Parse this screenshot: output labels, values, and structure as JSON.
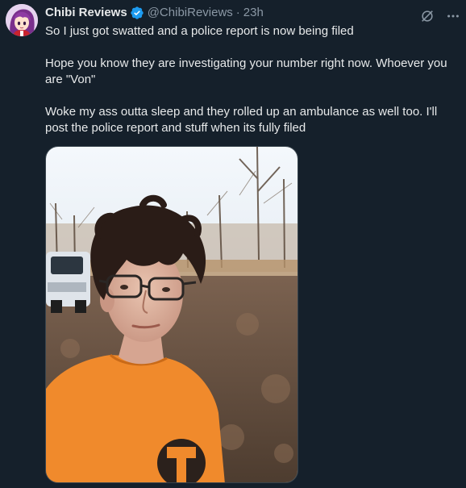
{
  "author": {
    "display_name": "Chibi Reviews",
    "handle": "@ChibiReviews",
    "separator": "·",
    "timestamp": "23h",
    "verified": true,
    "avatar_icon": "anime-avatar"
  },
  "tweet": {
    "paragraphs": [
      "So I just got swatted and a police report is now being filed",
      "Hope you know they are investigating your number right now. Whoever you are \"Von\"",
      "Woke my ass outta sleep and they rolled up an ambulance as well too. I'll post the police report and stuff when its fully filed"
    ]
  },
  "icons": {
    "grok": "grok-icon",
    "more": "more-options-icon"
  },
  "colors": {
    "background": "#15202b",
    "text_primary": "#e7e9ea",
    "text_secondary": "#8b98a5",
    "verified_blue": "#1d9bf0",
    "shirt_orange": "#f4892e"
  }
}
